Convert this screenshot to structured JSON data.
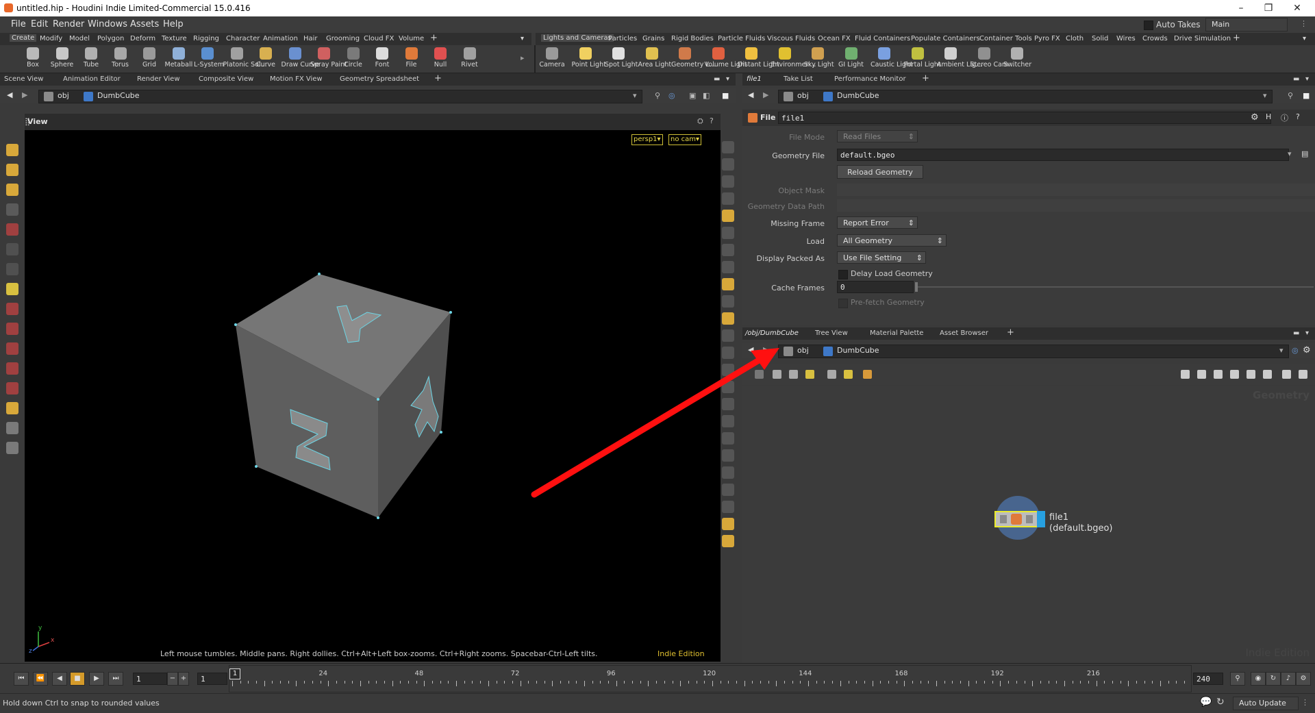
{
  "window": {
    "title": "untitled.hip - Houdini Indie Limited-Commercial 15.0.416",
    "buttons": [
      "–",
      "❐",
      "✕"
    ]
  },
  "menu": [
    "File",
    "Edit",
    "Render",
    "Windows",
    "Assets",
    "Help"
  ],
  "takes": {
    "auto_label": "Auto Takes",
    "main": "Main"
  },
  "shelf": {
    "left_tabs": [
      "Create",
      "Modify",
      "Model",
      "Polygon",
      "Deform",
      "Texture",
      "Rigging",
      "Character",
      "Animation",
      "Hair",
      "Grooming",
      "Cloud FX",
      "Volume"
    ],
    "right_tabs": [
      "Lights and Cameras",
      "Particles",
      "Grains",
      "Rigid Bodies",
      "Particle Fluids",
      "Viscous Fluids",
      "Ocean FX",
      "Fluid Containers",
      "Populate Containers",
      "Container Tools",
      "Pyro FX",
      "Cloth",
      "Solid",
      "Wires",
      "Crowds",
      "Drive Simulation"
    ],
    "left_tools": [
      {
        "label": "Box",
        "color": "#b9b9b9"
      },
      {
        "label": "Sphere",
        "color": "#c8c8c8"
      },
      {
        "label": "Tube",
        "color": "#b0b0b0"
      },
      {
        "label": "Torus",
        "color": "#a8a8a8"
      },
      {
        "label": "Grid",
        "color": "#9a9a9a"
      },
      {
        "label": "Metaball",
        "color": "#8fb0d8"
      },
      {
        "label": "L-System",
        "color": "#5a8fd0"
      },
      {
        "label": "Platonic Sol...",
        "color": "#a0a0a0"
      },
      {
        "label": "Curve",
        "color": "#d8b050"
      },
      {
        "label": "Draw Curve",
        "color": "#6a90d0"
      },
      {
        "label": "Spray Paint",
        "color": "#d06060"
      },
      {
        "label": "Circle",
        "color": "#7a7a7a"
      },
      {
        "label": "Font",
        "color": "#dcdcdc"
      },
      {
        "label": "File",
        "color": "#e07a3a"
      },
      {
        "label": "Null",
        "color": "#e05050"
      },
      {
        "label": "Rivet",
        "color": "#a0a0a0"
      }
    ],
    "right_tools": [
      {
        "label": "Camera",
        "color": "#9a9a9a"
      },
      {
        "label": "Point Light",
        "color": "#f0d060"
      },
      {
        "label": "Spot Light",
        "color": "#e0e0e0"
      },
      {
        "label": "Area Light",
        "color": "#e0c050"
      },
      {
        "label": "Geometry L...",
        "color": "#d07a4a"
      },
      {
        "label": "Volume Light",
        "color": "#e06040"
      },
      {
        "label": "Distant Light",
        "color": "#f0c040"
      },
      {
        "label": "Environmen...",
        "color": "#e0c030"
      },
      {
        "label": "Sky Light",
        "color": "#d0a050"
      },
      {
        "label": "GI Light",
        "color": "#70b070"
      },
      {
        "label": "Caustic Light",
        "color": "#7aa0e0"
      },
      {
        "label": "Portal Light",
        "color": "#c0c040"
      },
      {
        "label": "Ambient Lig...",
        "color": "#d0d0d0"
      },
      {
        "label": "Stereo Cam...",
        "color": "#909090"
      },
      {
        "label": "Switcher",
        "color": "#b0b0b0"
      }
    ]
  },
  "left_pane": {
    "tabs": [
      "Scene View",
      "Animation Editor",
      "Render View",
      "Composite View",
      "Motion FX View",
      "Geometry Spreadsheet"
    ],
    "path": [
      "obj",
      "DumbCube"
    ],
    "view_title": "View",
    "persp": "persp1▾",
    "cam": "no cam▾",
    "hint": "Left mouse tumbles. Middle pans. Right dollies. Ctrl+Alt+Left box-zooms. Ctrl+Right zooms. Spacebar-Ctrl-Left tilts.",
    "edition": "Indie Edition",
    "axis": {
      "x": "x",
      "y": "y",
      "z": "z"
    },
    "cube_letters": {
      "top": "Y",
      "front": "Z",
      "side": "X"
    }
  },
  "param_pane": {
    "tabs": [
      "file1",
      "Take List",
      "Performance Monitor"
    ],
    "path": [
      "obj",
      "DumbCube"
    ],
    "node_type": "File",
    "node_name": "file1",
    "params": {
      "file_mode": {
        "label": "File Mode",
        "value": "Read Files"
      },
      "geometry_file": {
        "label": "Geometry File",
        "value": "default.bgeo"
      },
      "reload": "Reload Geometry",
      "object_mask": {
        "label": "Object Mask"
      },
      "data_path": {
        "label": "Geometry Data Path"
      },
      "missing_frame": {
        "label": "Missing Frame",
        "value": "Report Error"
      },
      "load": {
        "label": "Load",
        "value": "All Geometry"
      },
      "display_packed": {
        "label": "Display Packed As",
        "value": "Use File Setting"
      },
      "delay_load": "Delay Load Geometry",
      "cache_frames": {
        "label": "Cache Frames",
        "value": "0"
      },
      "prefetch": "Pre-fetch Geometry"
    }
  },
  "network_pane": {
    "tabs": [
      "/obj/DumbCube",
      "Tree View",
      "Material Palette",
      "Asset Browser"
    ],
    "path": [
      "obj",
      "DumbCube"
    ],
    "context_label": "Geometry",
    "watermark": "Indie Edition",
    "node": {
      "name": "file1",
      "sub": "(default.bgeo)"
    }
  },
  "timeline": {
    "start": "1",
    "current": "1",
    "marker": "1",
    "end": "240",
    "ticks": [
      "24",
      "48",
      "72",
      "96",
      "120",
      "144",
      "168",
      "192",
      "216"
    ]
  },
  "status": {
    "message": "Hold down Ctrl to snap to rounded values",
    "update": "Auto Update"
  },
  "annotation_color": "#ff1010"
}
